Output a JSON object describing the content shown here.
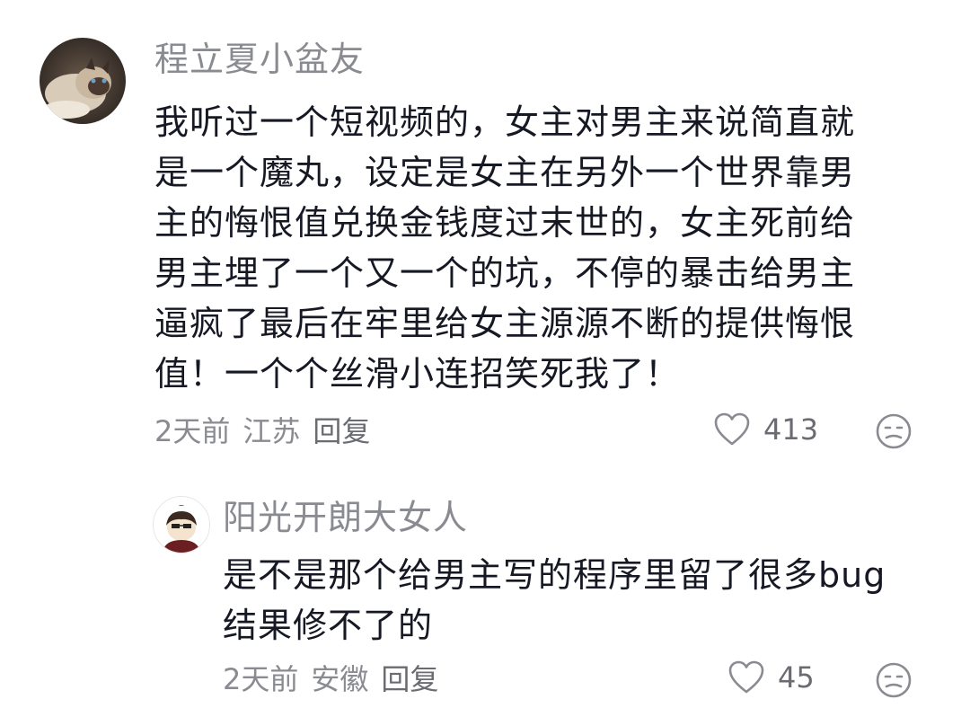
{
  "comments": [
    {
      "username": "程立夏小盆友",
      "text_lines": [
        "我听过一个短视频的，女主对男主来说简直就",
        "是一个魔丸，设定是女主在另外一个世界靠男",
        "主的悔恨值兑换金钱度过末世的，女主死前给",
        "男主埋了一个又一个的坑，不停的暴击给男主",
        "逼疯了最后在牢里给女主源源不断的提供悔恨",
        "值！一个个丝滑小连招笑死我了！"
      ],
      "time": "2天前",
      "location": "江苏",
      "reply_label": "回复",
      "like_count": "413"
    },
    {
      "username": "阳光开朗大女人",
      "text_lines": [
        "是不是那个给男主写的程序里留了很多bug",
        "结果修不了的"
      ],
      "time": "2天前",
      "location": "安徽",
      "reply_label": "回复",
      "like_count": "45"
    }
  ],
  "colors": {
    "secondary_text": "#8a8b91",
    "primary_text": "#161823",
    "icon": "#8a8b91"
  },
  "icons": [
    "heart-icon",
    "dislike-face-icon"
  ]
}
